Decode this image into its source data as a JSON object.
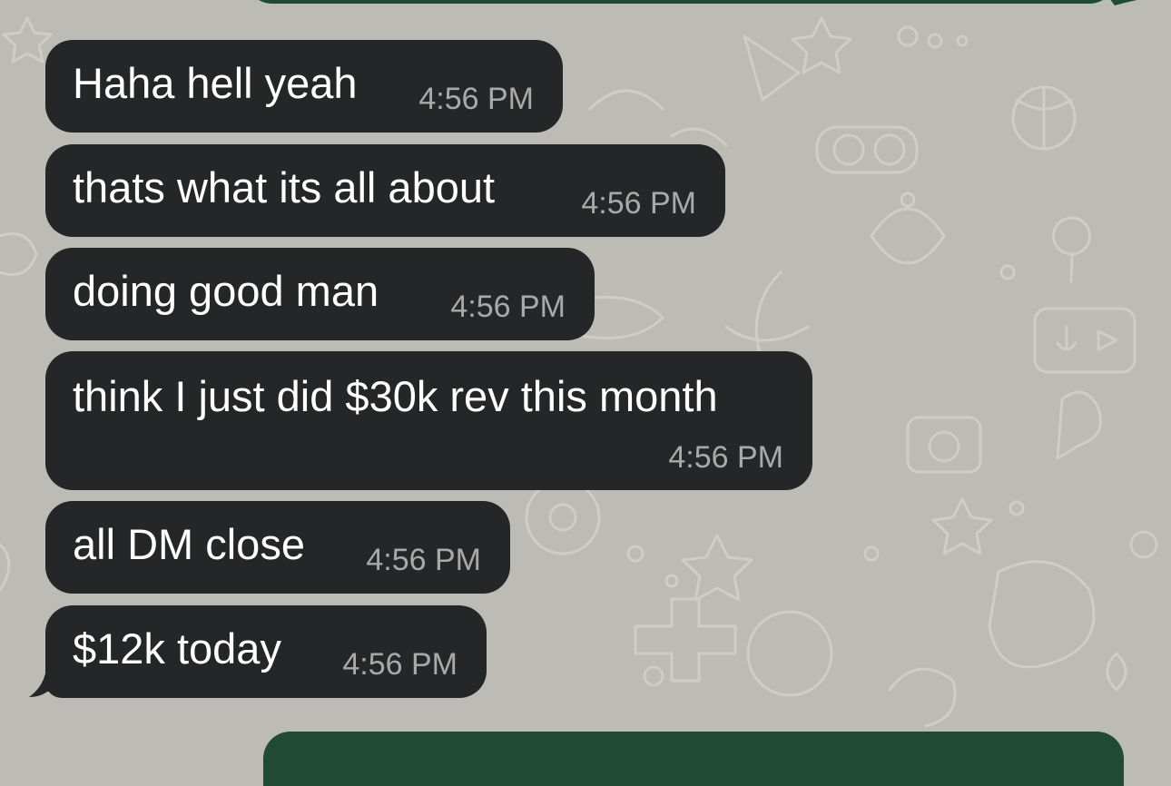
{
  "chat": {
    "messages": [
      {
        "text": "Haha hell yeah",
        "time": "4:56 PM"
      },
      {
        "text": "thats what its all about",
        "time": "4:56 PM"
      },
      {
        "text": "doing good man",
        "time": "4:56 PM"
      },
      {
        "text": "think I just did $30k rev this month",
        "time": "4:56 PM"
      },
      {
        "text": "all DM close",
        "time": "4:56 PM"
      },
      {
        "text": "$12k today",
        "time": "4:56 PM"
      }
    ]
  },
  "colors": {
    "wallpaper": "#bdbbb6",
    "incoming_bubble": "#252627",
    "outgoing_bubble": "#214a35",
    "message_text": "#ffffff",
    "timestamp_text": "#a9a9a9"
  }
}
